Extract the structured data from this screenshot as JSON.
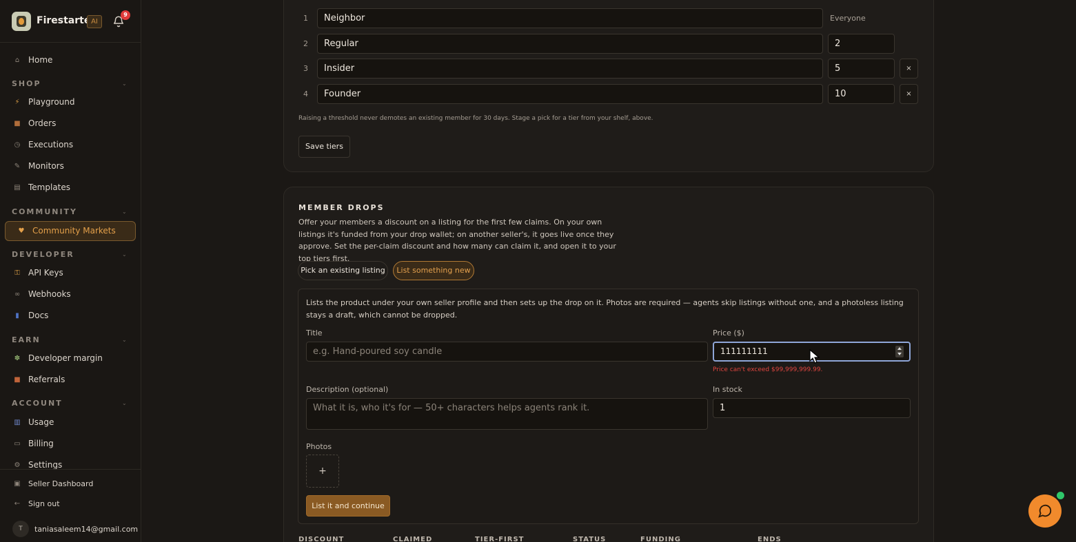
{
  "app": {
    "name": "Firestarter",
    "ai_badge": "AI",
    "notification_count": "9",
    "user_initial": "T",
    "user_email": "taniasaleem14@gmail.com"
  },
  "sidebar": {
    "home": "Home",
    "sections": {
      "shop": "SHOP",
      "community": "COMMUNITY",
      "developer": "DEVELOPER",
      "earn": "EARN",
      "account": "ACCOUNT"
    },
    "shop_items": [
      "Playground",
      "Orders",
      "Executions",
      "Monitors",
      "Templates"
    ],
    "community_items": [
      "Community Markets"
    ],
    "developer_items": [
      "API Keys",
      "Webhooks",
      "Docs"
    ],
    "earn_items": [
      "Developer margin",
      "Referrals"
    ],
    "account_items": [
      "Usage",
      "Billing",
      "Settings"
    ],
    "seller_dashboard": "Seller Dashboard",
    "sign_out": "Sign out"
  },
  "tiers": {
    "rows": [
      {
        "num": "1",
        "name": "Neighbor",
        "orders": "Everyone"
      },
      {
        "num": "2",
        "name": "Regular",
        "orders": "2"
      },
      {
        "num": "3",
        "name": "Insider",
        "orders": "5"
      },
      {
        "num": "4",
        "name": "Founder",
        "orders": "10"
      }
    ],
    "remove_label": "×",
    "note": "Raising a threshold never demotes an existing member for 30 days. Stage a pick for a tier from your shelf, above.",
    "save_label": "Save tiers"
  },
  "drops": {
    "title": "MEMBER DROPS",
    "description": "Offer your members a discount on a listing for the first few claims. On your own listings it's funded from your drop wallet; on another seller's, it goes live once they approve. Set the per-claim discount and how many can claim it, and open it to your top tiers first.",
    "tabs": [
      "Pick an existing listing",
      "List something new"
    ],
    "form": {
      "info": "Lists the product under your own seller profile and then sets up the drop on it. Photos are required — agents skip listings without one, and a photoless listing stays a draft, which cannot be dropped.",
      "title_label": "Title",
      "title_placeholder": "e.g. Hand-poured soy candle",
      "price_label": "Price ($)",
      "price_value": "111111111",
      "price_error": "Price can't exceed $99,999,999.99.",
      "description_label": "Description (optional)",
      "description_placeholder": "What it is, who it's for — 50+ characters helps agents rank it.",
      "stock_label": "In stock",
      "stock_value": "1",
      "photos_label": "Photos",
      "add_photo": "+",
      "submit_label": "List it and continue"
    },
    "table_headers": [
      "DISCOUNT",
      "CLAIMED",
      "TIER-FIRST",
      "STATUS",
      "FUNDING",
      "ENDS"
    ]
  },
  "colors": {
    "accent": "#c8842f",
    "focus": "#8fa6d8",
    "error": "#e0453f",
    "chat_fab": "#f18a2c",
    "online": "#2fc76a"
  }
}
